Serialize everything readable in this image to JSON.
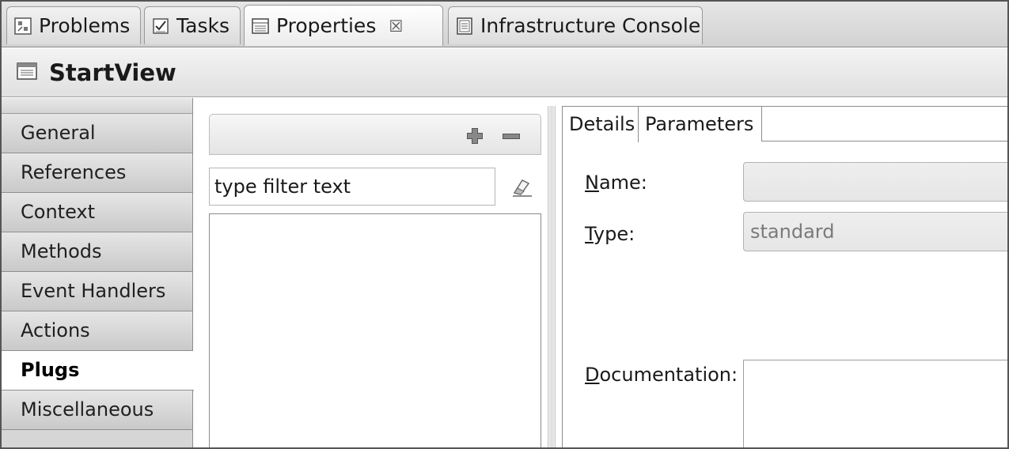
{
  "view_tabs": [
    {
      "label": "Problems",
      "icon": "problems-icon"
    },
    {
      "label": "Tasks",
      "icon": "tasks-icon"
    },
    {
      "label": "Properties",
      "icon": "properties-icon",
      "active": true,
      "close": "☒"
    },
    {
      "label": "Infrastructure Console",
      "icon": "console-icon"
    }
  ],
  "header": {
    "title": "StartView",
    "icon": "view-icon"
  },
  "nav": {
    "items": [
      {
        "label": "General"
      },
      {
        "label": "References"
      },
      {
        "label": "Context"
      },
      {
        "label": "Methods"
      },
      {
        "label": "Event Handlers"
      },
      {
        "label": "Actions"
      },
      {
        "label": "Plugs",
        "selected": true
      },
      {
        "label": "Miscellaneous"
      }
    ]
  },
  "middle": {
    "add_icon": "plus-icon",
    "remove_icon": "minus-icon",
    "filter_value": "type filter text",
    "clear_icon": "eraser-icon"
  },
  "right": {
    "tabs": [
      {
        "label": "Details",
        "active": true
      },
      {
        "label": "Parameters"
      }
    ],
    "name_label_key": "N",
    "name_label_rest": "ame:",
    "name_value": "",
    "type_label_key": "T",
    "type_label_rest": "ype:",
    "type_value": "standard",
    "doc_label_key": "D",
    "doc_label_rest": "ocumentation:",
    "doc_value": ""
  }
}
